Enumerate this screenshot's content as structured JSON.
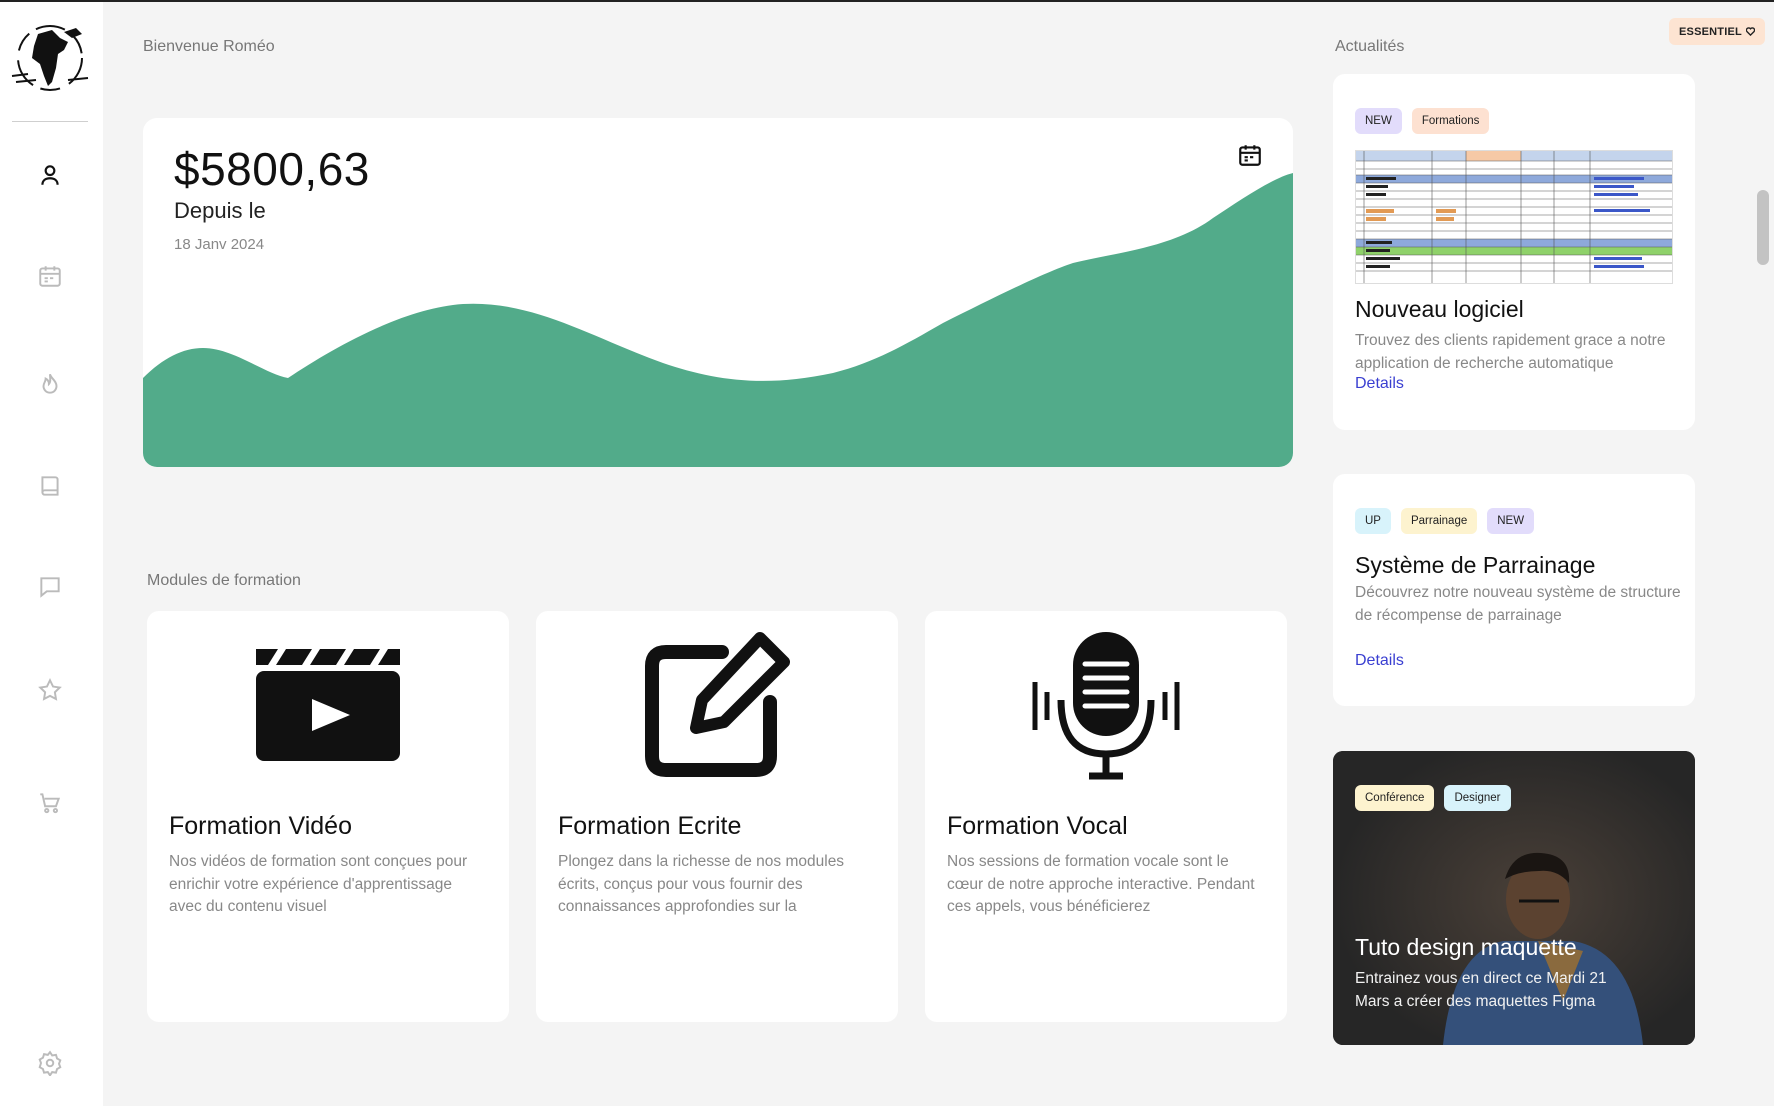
{
  "header": {
    "welcome": "Bienvenue Roméo",
    "news_heading": "Actualités",
    "plan_badge": "ESSENTIEL"
  },
  "sidebar": {
    "icons": [
      "user-icon",
      "calendar-icon",
      "flame-icon",
      "book-icon",
      "chat-icon",
      "star-icon",
      "cart-icon",
      "settings-icon"
    ]
  },
  "balance": {
    "amount": "$5800,63",
    "since_label": "Depuis le",
    "date": "18 Janv 2024",
    "chart_color": "#52ab8a"
  },
  "modules": {
    "heading": "Modules de formation",
    "items": [
      {
        "icon": "clapperboard-icon",
        "title": "Formation Vidéo",
        "desc": "Nos vidéos de formation sont conçues pour enrichir votre expérience d'apprentissage avec du contenu visuel"
      },
      {
        "icon": "edit-icon",
        "title": "Formation Ecrite",
        "desc": "Plongez dans la richesse de nos modules écrits, conçus pour vous fournir des connaissances approfondies sur la"
      },
      {
        "icon": "microphone-icon",
        "title": "Formation Vocal",
        "desc": "Nos sessions de formation vocale sont le cœur de notre approche interactive. Pendant ces appels, vous bénéficierez"
      }
    ]
  },
  "news": [
    {
      "tags": [
        {
          "label": "NEW",
          "color": "#e2dcfb"
        },
        {
          "label": "Formations",
          "color": "#fde1d1"
        }
      ],
      "title": "Nouveau logiciel",
      "desc": "Trouvez des clients rapidement grace a notre application de recherche automatique",
      "link": "Details"
    },
    {
      "tags": [
        {
          "label": "UP",
          "color": "#d8f3fb"
        },
        {
          "label": "Parrainage",
          "color": "#fdf3cf"
        },
        {
          "label": "NEW",
          "color": "#e2dcfb"
        }
      ],
      "title": "Système de Parrainage",
      "desc": "Découvrez notre nouveau système de structure de récompense de parrainage",
      "link": "Details"
    },
    {
      "tags": [
        {
          "label": "Conférence",
          "color": "#fdf3cf"
        },
        {
          "label": "Designer",
          "color": "#d8f3fb"
        }
      ],
      "title": "Tuto design maquette",
      "desc": "Entrainez vous en direct ce Mardi 21 Mars a créer des maquettes Figma"
    }
  ]
}
